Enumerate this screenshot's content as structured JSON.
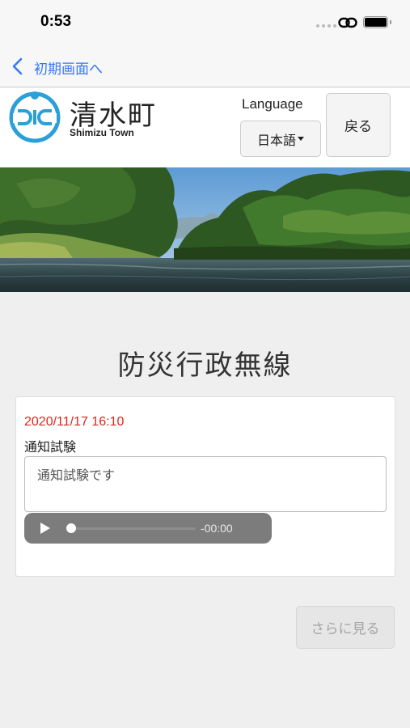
{
  "status_bar": {
    "time": "0:53",
    "icons": [
      "signal-dots-icon",
      "link-icon",
      "battery-icon"
    ]
  },
  "nav": {
    "back_label": "初期画面へ",
    "back_icon": "chevron-left-icon",
    "accent_color": "#3478f6"
  },
  "header": {
    "town_name": "清水町",
    "town_name_en": "Shimizu Town",
    "logo_icon": "shimizu-town-emblem-icon",
    "language_label": "Language",
    "language_value": "日本語",
    "back_button": "戻る"
  },
  "banner": {
    "icon": "river-forest-photo"
  },
  "main": {
    "title": "防災行政無線",
    "messages": [
      {
        "date": "2020/11/17 16:10",
        "subject": "通知試験",
        "body": "通知試験です",
        "audio_time": "-00:00"
      }
    ],
    "more_button": "さらに見る",
    "date_color": "#e0251b"
  }
}
